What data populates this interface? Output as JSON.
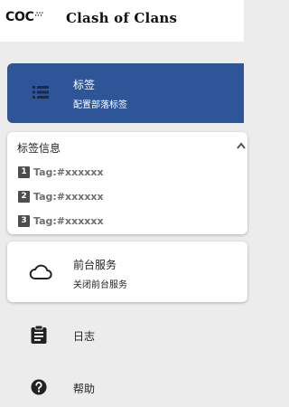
{
  "header": {
    "logo_text": "COC",
    "logo_small": "∴∵",
    "app_title": "Clash of Clans"
  },
  "menu": {
    "tags": {
      "icon": "list-icon",
      "title": "标签",
      "subtitle": "配置部落标签"
    },
    "tag_info": {
      "title": "标签信息",
      "toggle_icon": "chevron-up-icon",
      "tags": [
        {
          "index": "1",
          "text": "Tag:#xxxxxx"
        },
        {
          "index": "2",
          "text": "Tag:#xxxxxx"
        },
        {
          "index": "3",
          "text": "Tag:#xxxxxx"
        }
      ]
    },
    "foreground_service": {
      "icon": "cloud-icon",
      "title": "前台服务",
      "subtitle": "关闭前台服务"
    },
    "log": {
      "icon": "clipboard-icon",
      "label": "日志"
    },
    "help": {
      "icon": "help-circle-icon",
      "label": "帮助"
    }
  },
  "colors": {
    "selected_background": "#2d5597",
    "page_background": "#ececec",
    "card_background": "#ffffff",
    "tag_text": "#6f6f6f",
    "tag_badge": "#4d4d4d"
  }
}
